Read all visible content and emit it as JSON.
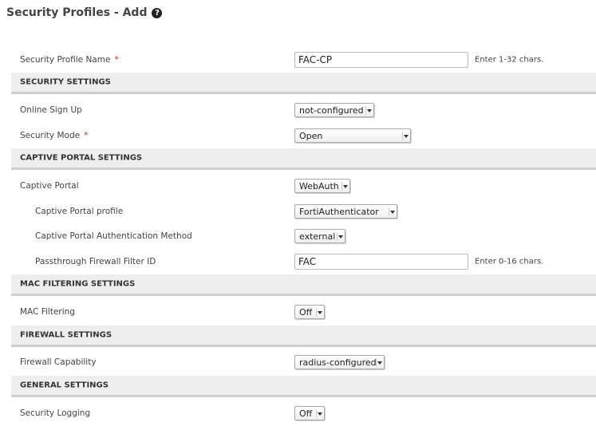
{
  "header": {
    "title": "Security Profiles - Add",
    "help_icon": "question-circle-icon"
  },
  "form": {
    "profile_name": {
      "label": "Security Profile Name",
      "value": "FAC-CP",
      "hint": "Enter 1-32 chars.",
      "required": "*"
    },
    "security_settings": {
      "heading": "SECURITY SETTINGS",
      "online_sign_up": {
        "label": "Online Sign Up",
        "value": "not-configured"
      },
      "security_mode": {
        "label": "Security Mode",
        "value": "Open",
        "required": "*"
      }
    },
    "captive_portal_settings": {
      "heading": "CAPTIVE PORTAL SETTINGS",
      "captive_portal": {
        "label": "Captive Portal",
        "value": "WebAuth"
      },
      "captive_portal_profile": {
        "label": "Captive Portal profile",
        "value": "FortiAuthenticator"
      },
      "auth_method": {
        "label": "Captive Portal Authentication Method",
        "value": "external"
      },
      "passthrough_filter": {
        "label": "Passthrough Firewall Filter ID",
        "value": "FAC",
        "hint": "Enter 0-16 chars."
      }
    },
    "mac_filtering_settings": {
      "heading": "MAC FILTERING SETTINGS",
      "mac_filtering": {
        "label": "MAC Filtering",
        "value": "Off"
      }
    },
    "firewall_settings": {
      "heading": "FIREWALL SETTINGS",
      "firewall_capability": {
        "label": "Firewall Capability",
        "value": "radius-configured"
      }
    },
    "general_settings": {
      "heading": "GENERAL SETTINGS",
      "security_logging": {
        "label": "Security Logging",
        "value": "Off"
      }
    }
  },
  "colors": {
    "required": "#dd2222",
    "section_bg": "#eeeeee",
    "section_border": "#cfcfcf"
  }
}
